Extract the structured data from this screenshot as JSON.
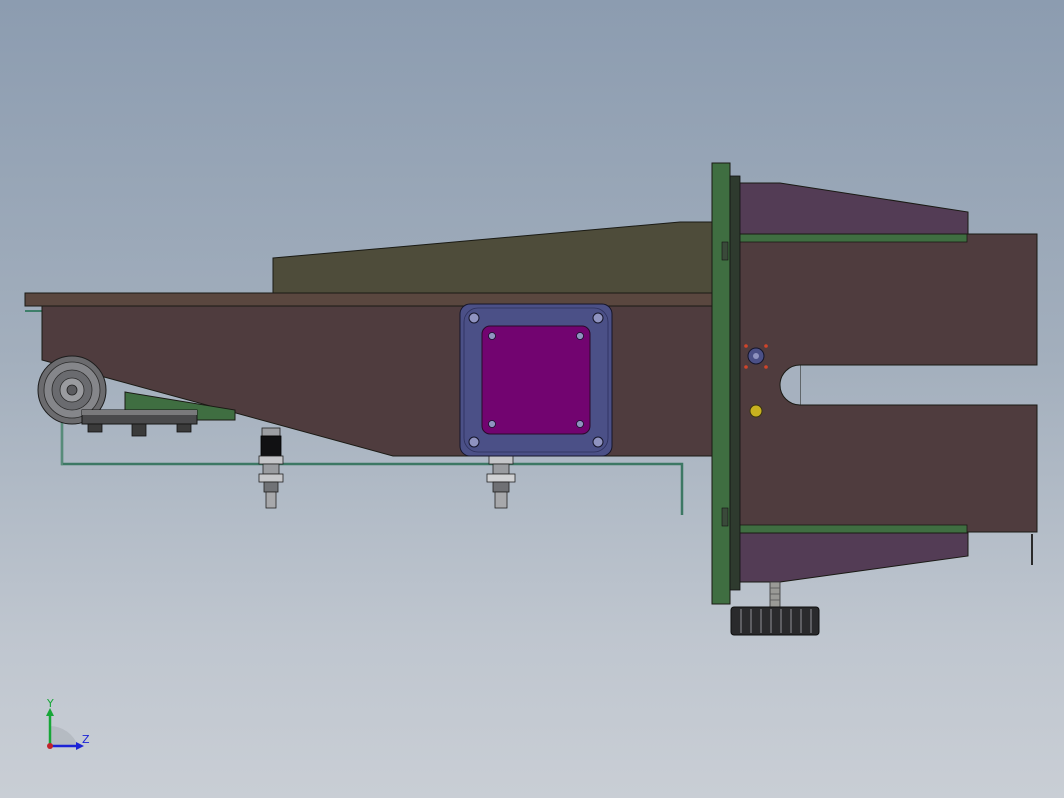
{
  "triad": {
    "y_label": "Y",
    "z_label": "Z"
  },
  "colors": {
    "background_top": "#8c9cb0",
    "background_bottom": "#c9ced5",
    "frame_body": "#4f3c3e",
    "top_plate": "#4e4c3a",
    "mount_plate": "#4b5087",
    "motor_face": "#720470",
    "green_plate": "#3f6e41",
    "wedge": "#533c55",
    "axis_y": "#16a637",
    "axis_z": "#1c23d6",
    "origin": "#c2222a"
  }
}
